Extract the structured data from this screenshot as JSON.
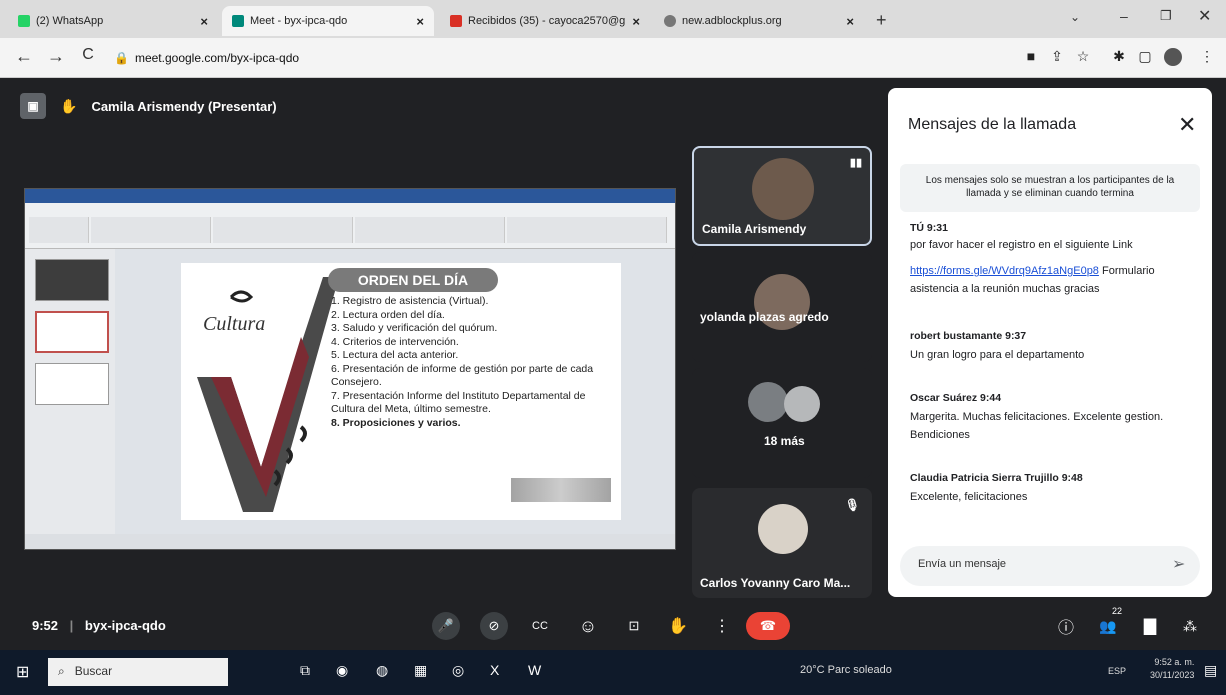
{
  "browser": {
    "tabs": [
      {
        "label": "(2) WhatsApp",
        "icon": "whatsapp-icon"
      },
      {
        "label": "Meet - byx-ipca-qdo",
        "icon": "meet-icon"
      },
      {
        "label": "Recibidos (35) - cayoca2570@g",
        "icon": "gmail-icon"
      },
      {
        "label": "new.adblockplus.org",
        "icon": "globe-icon"
      }
    ],
    "url": "meet.google.com/byx-ipca-qdo"
  },
  "meet": {
    "presenter_label": "Camila Arismendy (Presentar)",
    "slide": {
      "title": "ORDEN DEL DÍA",
      "logo": "Cultura",
      "items": [
        "1. Registro de asistencia (Virtual).",
        "2. Lectura orden del día.",
        "3. Saludo y verificación del quórum.",
        "4. Criterios de intervención.",
        "5. Lectura del acta anterior.",
        "6. Presentación de informe de gestión por parte de cada Consejero.",
        "7. Presentación Informe del Instituto Departamental de Cultura del Meta, último semestre.",
        "8. Proposiciones y varios."
      ]
    },
    "participants": [
      {
        "name": "Camila Arismendy"
      },
      {
        "name": "yolanda plazas agredo"
      },
      {
        "name": "18 más"
      },
      {
        "name": "Carlos Yovanny Caro Ma..."
      }
    ],
    "chat": {
      "title": "Mensajes de la llamada",
      "notice": "Los mensajes solo se muestran a los participantes de la llamada y se eliminan cuando termina",
      "messages": [
        {
          "sender": "TÚ 9:31",
          "lines": [
            "por favor hacer el registro en el siguiente Link"
          ]
        },
        {
          "sender": "",
          "link": "https://forms.gle/WVdrq9Afz1aNgE0p8",
          "lines": [
            "Formulario asistencia a la reunión muchas gracias"
          ]
        },
        {
          "sender": "robert bustamante 9:37",
          "lines": [
            "Un gran logro para el departamento"
          ]
        },
        {
          "sender": "Oscar Suárez 9:44",
          "lines": [
            "Margerita. Muchas felicitaciones. Excelente gestion. Bendiciones"
          ]
        },
        {
          "sender": "Claudia Patricia Sierra Trujillo 9:48",
          "lines": [
            "Excelente, felicitaciones"
          ]
        }
      ],
      "input_placeholder": "Envía un mensaje"
    },
    "time": "9:52",
    "meeting_code": "byx-ipca-qdo",
    "participant_count": "22"
  },
  "taskbar": {
    "search": "Buscar",
    "weather": "20°C Parc soleado",
    "time": "9:52 a. m.",
    "date": "30/11/2023",
    "lang": "ESP"
  }
}
